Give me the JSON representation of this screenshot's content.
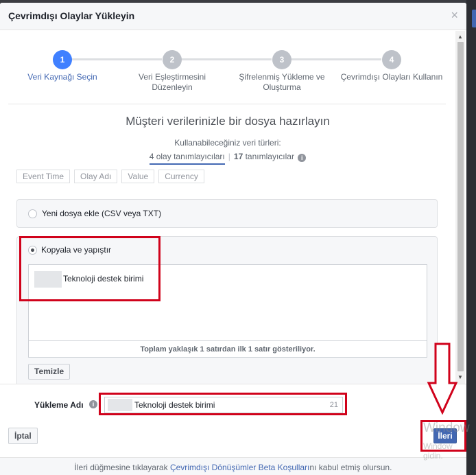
{
  "dialog": {
    "title": "Çevrimdışı Olaylar Yükleyin",
    "close_icon": "close-icon"
  },
  "steps": [
    {
      "number": "1",
      "label_line1": "Veri Kaynağı Seçin",
      "label_line2": "",
      "active": true
    },
    {
      "number": "2",
      "label_line1": "Veri Eşleştirmesini",
      "label_line2": "Düzenleyin",
      "active": false
    },
    {
      "number": "3",
      "label_line1": "Şifrelenmiş Yükleme ve",
      "label_line2": "Oluşturma",
      "active": false
    },
    {
      "number": "4",
      "label_line1": "Çevrimdışı Olayları Kullanın",
      "label_line2": "",
      "active": false
    }
  ],
  "main": {
    "section_title": "Müşteri verilerinizle bir dosya hazırlayın",
    "data_types_label": "Kullanabileceğiniz veri türleri:",
    "tab_event_count": "4",
    "tab_event_text": "olay tanımlayıcıları",
    "tab_id_count": "17",
    "tab_id_text": "tanımlayıcılar",
    "info_icon": "info-icon",
    "chips": [
      "Event Time",
      "Olay Adı",
      "Value",
      "Currency"
    ]
  },
  "options": {
    "new_file_label": "Yeni dosya ekle (CSV veya TXT)",
    "paste_label": "Kopyala ve yapıştır",
    "paste_content": "Teknoloji destek birimi",
    "paste_footer": "Toplam yaklaşık 1 satırdan ilk 1 satır gösteriliyor.",
    "clear_label": "Temizle"
  },
  "upload": {
    "label": "Yükleme Adı",
    "value": "Teknoloji destek birimi",
    "count": "21"
  },
  "actions": {
    "cancel_label": "İptal",
    "next_label": "İleri"
  },
  "footer": {
    "text_before": "İleri düğmesine tıklayarak ",
    "link_text": "Çevrimdışı Dönüşümler Beta Koşulları",
    "text_after": "nı kabul etmiş olursun."
  },
  "watermark": {
    "line1": "Window",
    "line2": "Window",
    "line3": "gidin."
  },
  "colors": {
    "accent": "#4267b2",
    "step_active": "#4080ff",
    "annotation_red": "#d0021b"
  }
}
